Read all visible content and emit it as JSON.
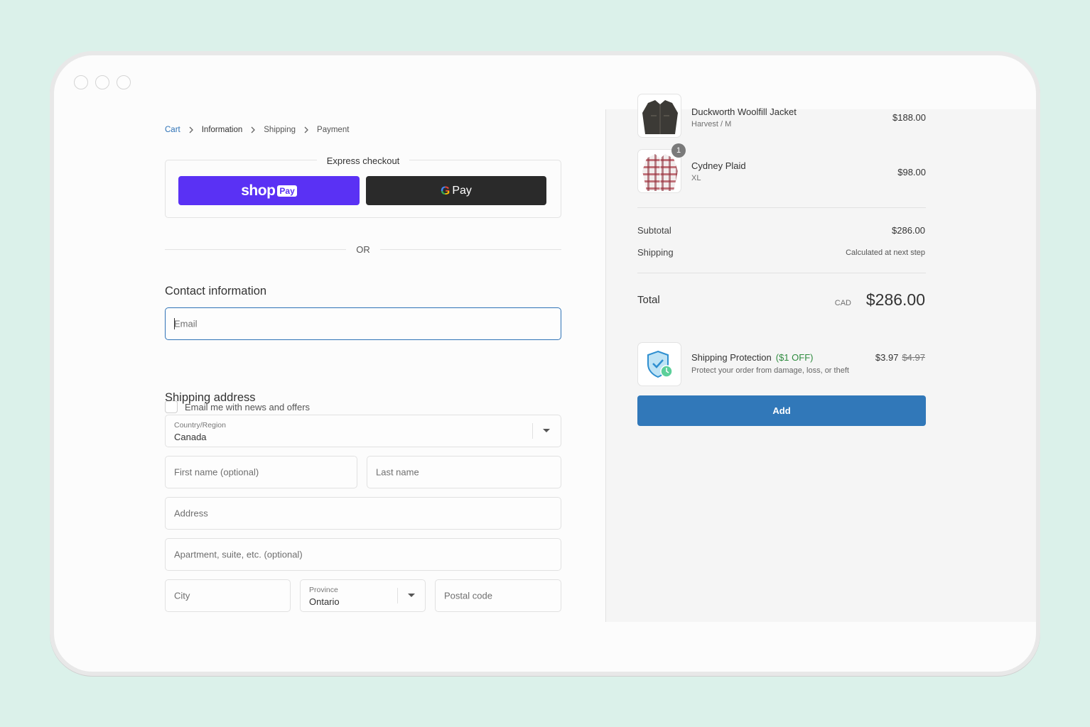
{
  "breadcrumb": {
    "cart": "Cart",
    "information": "Information",
    "shipping": "Shipping",
    "payment": "Payment"
  },
  "express": {
    "label": "Express checkout",
    "shop_pay_word": "shop",
    "shop_pay_box": "Pay",
    "gpay_g": "G",
    "gpay_word": "Pay"
  },
  "or_text": "OR",
  "contact": {
    "title": "Contact information",
    "email_placeholder": "Email",
    "newsletter_label": "Email me with news and offers"
  },
  "shipping": {
    "title": "Shipping address",
    "country_label": "Country/Region",
    "country_value": "Canada",
    "first_name_placeholder": "First name (optional)",
    "last_name_placeholder": "Last name",
    "address_placeholder": "Address",
    "apartment_placeholder": "Apartment, suite, etc. (optional)",
    "city_placeholder": "City",
    "province_label": "Province",
    "province_value": "Ontario",
    "postal_placeholder": "Postal code"
  },
  "cart": {
    "items": [
      {
        "name": "Duckworth Woolfill Jacket",
        "variant": "Harvest / M",
        "price": "$188.00"
      },
      {
        "name": "Cydney Plaid",
        "variant": "XL",
        "price": "$98.00",
        "quantity": "1"
      }
    ],
    "subtotal_label": "Subtotal",
    "subtotal_value": "$286.00",
    "shipping_label": "Shipping",
    "shipping_value": "Calculated at next step",
    "total_label": "Total",
    "total_currency": "CAD",
    "total_value": "$286.00"
  },
  "protection": {
    "title": "Shipping Protection",
    "discount": "($1 OFF)",
    "description": "Protect your order from damage, loss, or theft",
    "price": "$3.97",
    "old_price": "$4.97",
    "add_label": "Add"
  },
  "colors": {
    "background": "#dbf1ea",
    "shop_pay": "#5a31f4",
    "gpay": "#2a2a2a",
    "link": "#2f73b7",
    "add_button": "#3178b9",
    "discount": "#2e8b3e"
  }
}
